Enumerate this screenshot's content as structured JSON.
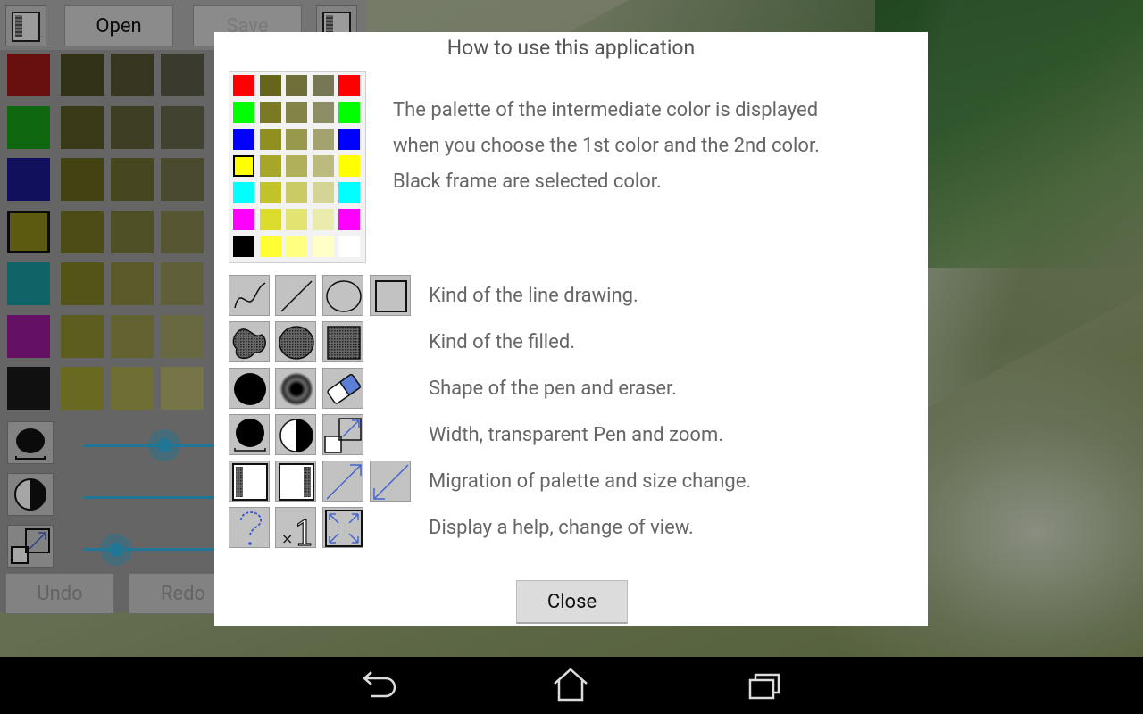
{
  "background_app": {
    "open_label": "Open",
    "save_label": "Save",
    "undo_label": "Undo",
    "redo_label": "Redo",
    "base_colors": [
      "#a01818",
      "#18a018",
      "#1a1a90",
      "#8c8a1a",
      "#1a9a9e",
      "#9a1a9a",
      "#1a1a1a"
    ],
    "selected_base_color_index": 3,
    "intermediate_colors": [
      [
        "#4e4e22",
        "#545434",
        "#5a5a48"
      ],
      [
        "#5a5a26",
        "#60603a",
        "#66664c"
      ],
      [
        "#66661e",
        "#6c6c34",
        "#727248"
      ],
      [
        "#767624",
        "#7c7c3c",
        "#84844e"
      ],
      [
        "#828226",
        "#8a8a42",
        "#929258"
      ],
      [
        "#909030",
        "#98984c",
        "#a2a264"
      ],
      [
        "#a2a234",
        "#aaaa52",
        "#b4b46e"
      ]
    ],
    "slider_levels": [
      0.6,
      1.0,
      0.25
    ]
  },
  "dialog": {
    "title": "How to use this application",
    "palette_description": [
      "The palette of the intermediate color is displayed",
      "when you choose the 1st color and the 2nd color.",
      "Black frame are selected color."
    ],
    "demo_palette": {
      "rows": [
        [
          "#ff0000",
          "#66661a",
          "#6f6f3a",
          "#777755",
          "#ff0000"
        ],
        [
          "#00ff00",
          "#7a7a22",
          "#838348",
          "#8d8d66",
          "#00ff00"
        ],
        [
          "#0000ff",
          "#8f8f22",
          "#99994e",
          "#a3a370",
          "#0000ff"
        ],
        [
          "#ffff00",
          "#a6a62a",
          "#b0b05a",
          "#bbbb80",
          "#ffff00"
        ],
        [
          "#00ffff",
          "#c2c22a",
          "#cbcb66",
          "#d4d496",
          "#00ffff"
        ],
        [
          "#ff00ff",
          "#dcdc2e",
          "#e3e372",
          "#ebebac",
          "#ff00ff"
        ],
        [
          "#000000",
          "#ffff33",
          "#ffff80",
          "#ffffc8",
          "#ffffff"
        ]
      ],
      "selected_row": 3,
      "selected_col": 0
    },
    "tool_rows": [
      {
        "label": "Kind of the line drawing.",
        "icons": [
          "freehand-line-icon",
          "straight-line-icon",
          "ellipse-outline-icon",
          "rectangle-outline-icon"
        ]
      },
      {
        "label": "Kind of the filled.",
        "icons": [
          "freehand-fill-icon",
          "ellipse-fill-icon",
          "rectangle-fill-icon"
        ]
      },
      {
        "label": "Shape of the pen and eraser.",
        "icons": [
          "round-pen-icon",
          "blur-pen-icon",
          "eraser-icon"
        ]
      },
      {
        "label": "Width, transparent Pen and zoom.",
        "icons": [
          "pen-width-icon",
          "transparency-icon",
          "zoom-icon"
        ]
      },
      {
        "label": "Migration of palette and size change.",
        "icons": [
          "palette-left-icon",
          "palette-right-icon",
          "enlarge-icon",
          "shrink-icon"
        ]
      },
      {
        "label": "Display a help, change of view.",
        "icons": [
          "help-icon",
          "actual-size-icon",
          "fit-view-icon"
        ]
      }
    ],
    "close_label": "Close"
  },
  "navbar": {
    "icons": [
      "back-icon",
      "home-icon",
      "recent-apps-icon"
    ]
  }
}
